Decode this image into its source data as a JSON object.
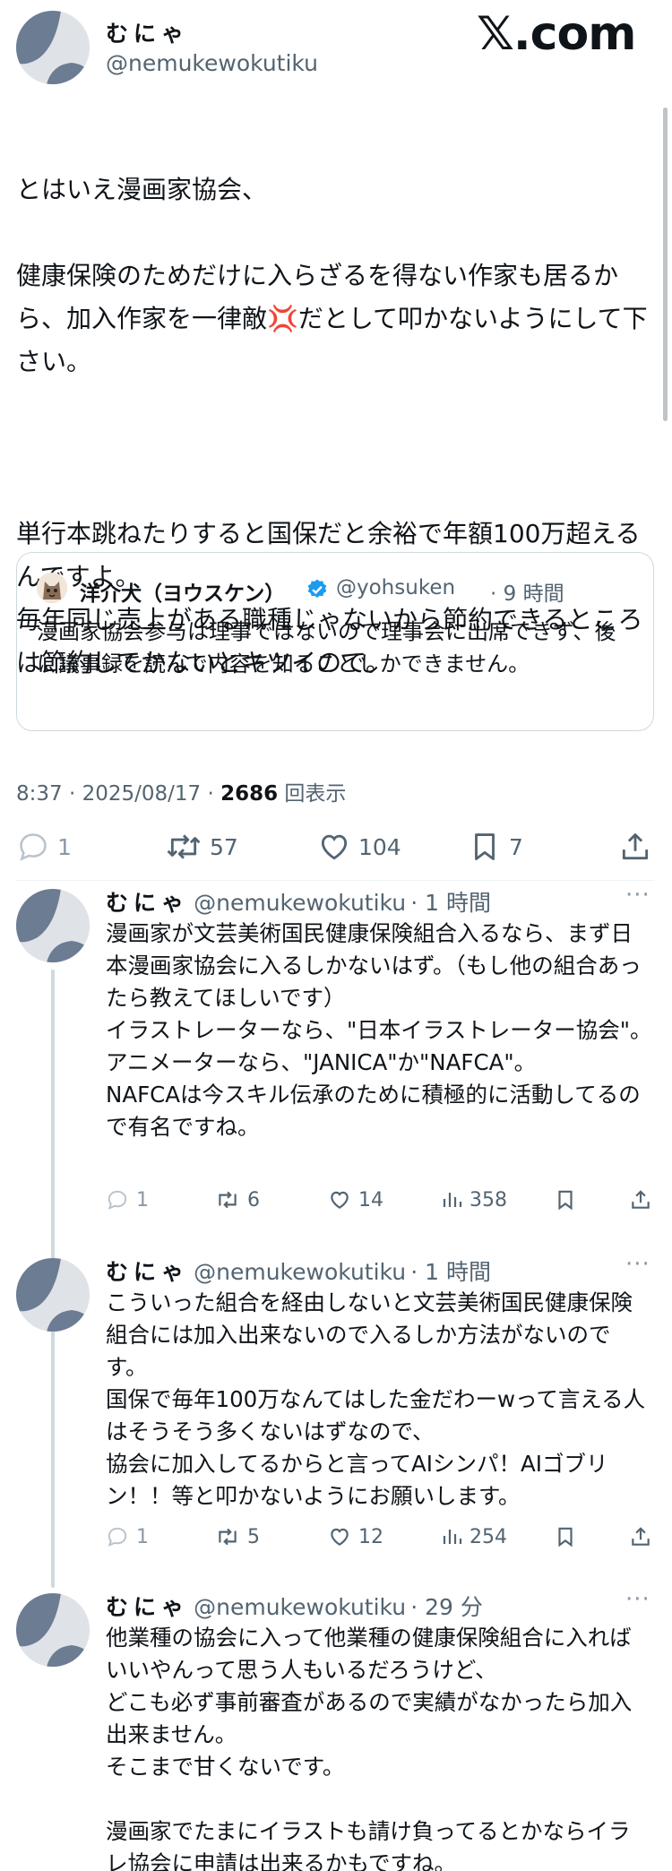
{
  "brand": {
    "logo_text": "𝕏.com"
  },
  "main_post": {
    "display_name": "むにゃ",
    "handle": "@nemukewokutiku",
    "text_line1": "とはいえ漫画家協会、",
    "text_line2a": "健康保険のためだけに入らざるを得ない作家も居る",
    "text_line2b": "から、加入作家を一律敵",
    "anger_emoji": "💢",
    "text_line2c": "だとして叩かないようにして下さい。",
    "text_para2": "単行本跳ねたりすると国保だと余裕で年額100万超えるんですよ。\n毎年同じ売上がある職種じゃないから節約できるところは節約してかないとキツイので。",
    "quote": {
      "display_name": "洋介犬（ヨウスケン）",
      "handle": "@yohsuken",
      "time": "· 9 時間",
      "text": "漫画家協会参与は理事ではないので理事会に出席できず、後に議事録を読んで内容を知ることしかできません。"
    },
    "meta_time": "8:37 · 2025/08/17 · ",
    "views_count": "2686",
    "views_label": " 回表示",
    "stats": {
      "replies": "1",
      "reposts": "57",
      "likes": "104",
      "bookmarks": "7"
    }
  },
  "replies": [
    {
      "display_name": "むにゃ",
      "handle": "@nemukewokutiku",
      "time": "· 1 時間",
      "text": "漫画家が文芸美術国民健康保険組合入るなら、まず日本漫画家協会に入るしかないはず。（もし他の組合あったら教えてほしいです）\nイラストレーターなら、\"日本イラストレーター協会\"。\nアニメーターなら、\"JANICA\"か\"NAFCA\"。\nNAFCAは今スキル伝承のために積極的に活動してるので有名ですね。",
      "stats": {
        "replies": "1",
        "reposts": "6",
        "likes": "14",
        "views": "358"
      }
    },
    {
      "display_name": "むにゃ",
      "handle": "@nemukewokutiku",
      "time": "· 1 時間",
      "text": "こういった組合を経由しないと文芸美術国民健康保険組合には加入出来ないので入るしか方法がないのです。\n国保で毎年100万なんてはした金だわーwって言える人はそうそう多くないはずなので、\n協会に加入してるからと言ってAIシンパ！AIゴブリン！！等と叩かないようにお願いします。",
      "stats": {
        "replies": "1",
        "reposts": "5",
        "likes": "12",
        "views": "254"
      }
    },
    {
      "display_name": "むにゃ",
      "handle": "@nemukewokutiku",
      "time": "· 29 分",
      "text": "他業種の協会に入って他業種の健康保険組合に入ればいいやんって思う人もいるだろうけど、\nどこも必ず事前審査があるので実績がなかったら加入出来ません。\nそこまで甘くないです。\n\n漫画家でたまにイラストも請け負ってるとかならイラレ協会に申請は出来るかもですね。"
    }
  ],
  "colors": {
    "text": "#0f1419",
    "muted": "#536471",
    "verified": "#1d9bf0",
    "thread_line": "#cfd9de",
    "border": "#cfd9de"
  }
}
